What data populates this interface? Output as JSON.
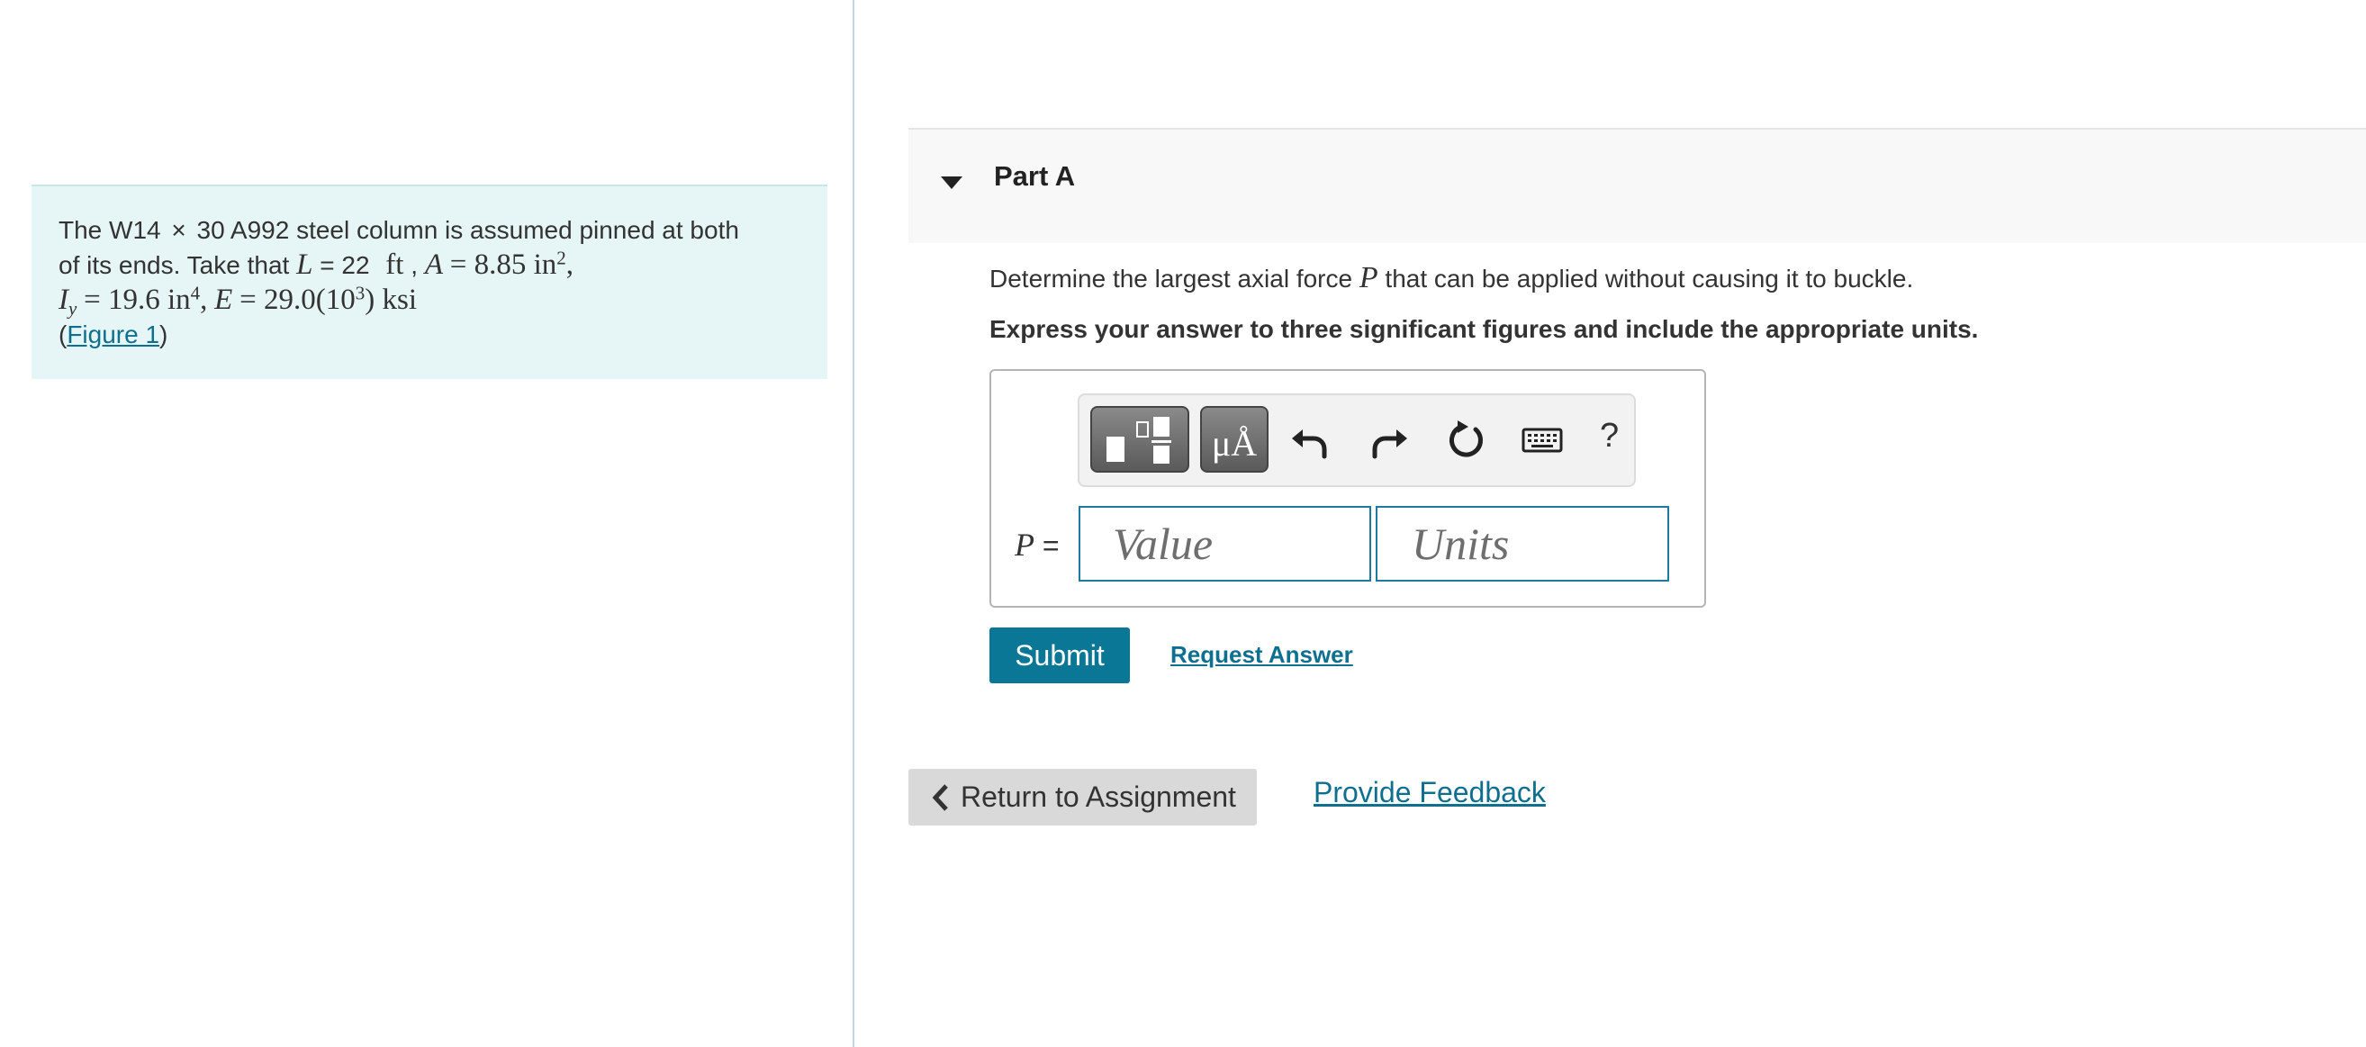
{
  "problem": {
    "text_1": "The W14",
    "times": "×",
    "text_2": "30 A992 steel column is assumed pinned at both",
    "line2_text": "of its ends. Take that",
    "L_sym": "L",
    "L_eq": "= 22",
    "ft": "ft",
    "A_sym": "A",
    "A_eq": "= 8.85 in",
    "A_exp": "2",
    "comma": ",",
    "Iy_sym": "I",
    "Iy_sub": "y",
    "Iy_eq": "= 19.6 in",
    "Iy_exp": "4",
    "E_sym": "E",
    "E_eq": "= 29.0(10",
    "E_exp": "3",
    "E_tail": ") ksi",
    "figure_open": "(",
    "figure_link": "Figure 1",
    "figure_close": ")"
  },
  "part": {
    "title": "Part A",
    "question_pre": "Determine the largest axial force",
    "question_var": "P",
    "question_post": "that can be applied without causing it to buckle.",
    "instruction": "Express your answer to three significant figures and include the appropriate units."
  },
  "toolbar": {
    "units_label": "μÅ",
    "help_label": "?",
    "icons": [
      "templates-icon",
      "units-icon",
      "undo-icon",
      "redo-icon",
      "reset-icon",
      "keyboard-icon",
      "help-icon"
    ]
  },
  "answer": {
    "var_label": "P",
    "eq": "=",
    "value_placeholder": "Value",
    "units_placeholder": "Units"
  },
  "actions": {
    "submit": "Submit",
    "request_answer": "Request Answer",
    "return": "Return to Assignment",
    "feedback": "Provide Feedback"
  },
  "colors": {
    "accent": "#0b7796",
    "link": "#0f6f8f",
    "problem_bg": "#e6f5f5",
    "field_border": "#1f7aa3"
  }
}
